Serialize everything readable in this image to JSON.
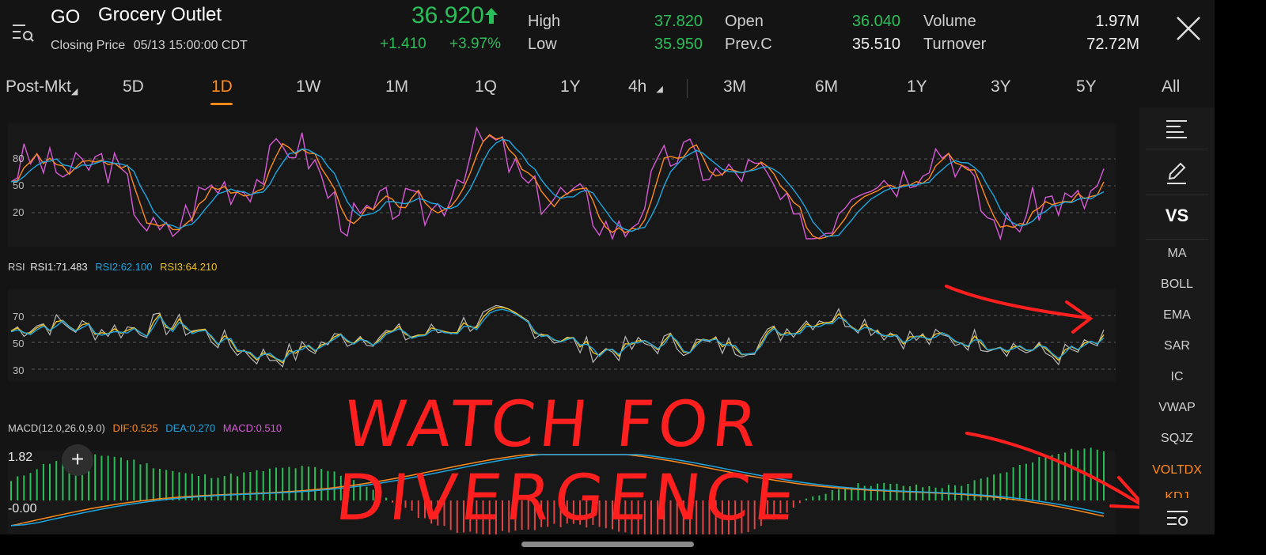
{
  "header": {
    "ticker": "GO",
    "company": "Grocery Outlet",
    "closing_label": "Closing Price",
    "closing_time": "05/13 15:00:00 CDT",
    "last_price": "36.920",
    "change": "+1.410",
    "change_pct": "+3.97%",
    "stats": {
      "high_label": "High",
      "high": "37.820",
      "low_label": "Low",
      "low": "35.950",
      "open_label": "Open",
      "open": "36.040",
      "prevc_label": "Prev.C",
      "prevc": "35.510",
      "volume_label": "Volume",
      "volume": "1.97M",
      "turnover_label": "Turnover",
      "turnover": "72.72M"
    }
  },
  "tabs": [
    "Post-Mkt",
    "5D",
    "1D",
    "1W",
    "1M",
    "1Q",
    "1Y",
    "4h",
    "3M",
    "6M",
    "1Y",
    "3Y",
    "5Y",
    "All"
  ],
  "active_tab": "1D",
  "indicators": {
    "kdj_levels": [
      "80",
      "50",
      "20"
    ],
    "rsi": {
      "label": "RSI",
      "rsi1": "RSI1:71.483",
      "rsi2": "RSI2:62.100",
      "rsi3": "RSI3:64.210",
      "levels": [
        "70",
        "50",
        "30"
      ]
    },
    "macd": {
      "label": "MACD(12.0,26.0,9.0)",
      "dif": "DIF:0.525",
      "dea": "DEA:0.270",
      "macd": "MACD:0.510",
      "top": "1.82",
      "zero": "-0.00"
    }
  },
  "sidebar": {
    "items": [
      "MA",
      "BOLL",
      "EMA",
      "SAR",
      "IC",
      "VWAP",
      "SQJZ",
      "VOLTDX",
      "KDJ"
    ],
    "active": "VOLTDX",
    "vs_label": "VS"
  },
  "annotation": "WATCH FOR DIVERGENCE",
  "colors": {
    "green": "#2bbf5a",
    "orange": "#ff8a1c",
    "blue": "#1ea6e0",
    "magenta": "#d65ad6",
    "yellow": "#f0c020",
    "red_annotation": "#ff1f1f",
    "macd_up": "#2bbf5a",
    "macd_down": "#e04545"
  },
  "icons": [
    "menu-search-icon",
    "up-arrow-icon",
    "close-icon",
    "list-icon",
    "pencil-icon",
    "settings-list-icon",
    "plus-icon"
  ]
}
